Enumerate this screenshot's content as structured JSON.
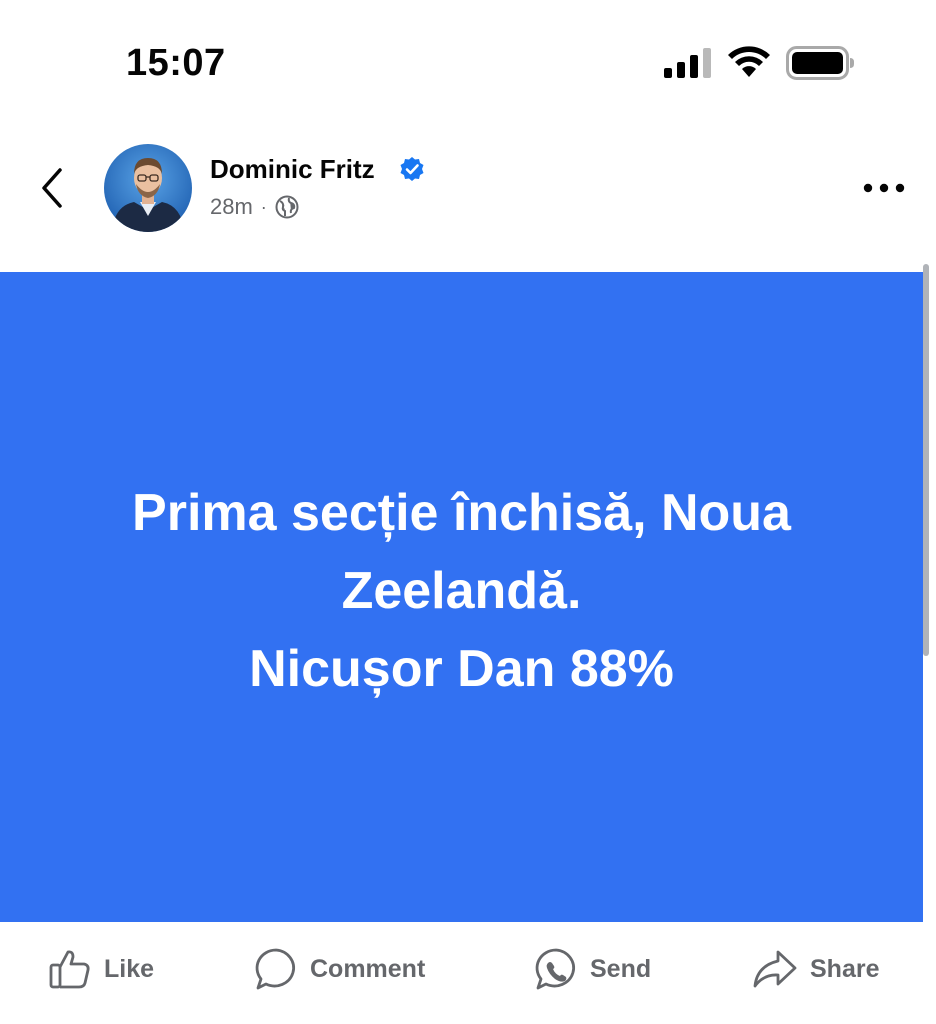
{
  "status_bar": {
    "time": "15:07",
    "icons": [
      "signal-icon",
      "wifi-icon",
      "battery-icon"
    ]
  },
  "post": {
    "author": "Dominic Fritz",
    "verified": true,
    "time_ago": "28m",
    "separator": "·",
    "audience_icon": "globe-icon",
    "background_color": "#3271f2",
    "text_lines": [
      "Prima secție închisă, Noua",
      "Zeelandă.",
      "Nicușor Dan 88%"
    ]
  },
  "header": {
    "back_icon": "chevron-left-icon",
    "more_icon": "more-horizontal-icon"
  },
  "actions": [
    {
      "label": "Like",
      "icon": "thumbs-up-icon"
    },
    {
      "label": "Comment",
      "icon": "comment-bubble-icon"
    },
    {
      "label": "Send",
      "icon": "messenger-send-icon"
    },
    {
      "label": "Share",
      "icon": "share-arrow-icon"
    }
  ],
  "colors": {
    "verified_badge": "#1877f2",
    "secondary_text": "#65676b",
    "post_background": "#3271f2"
  }
}
